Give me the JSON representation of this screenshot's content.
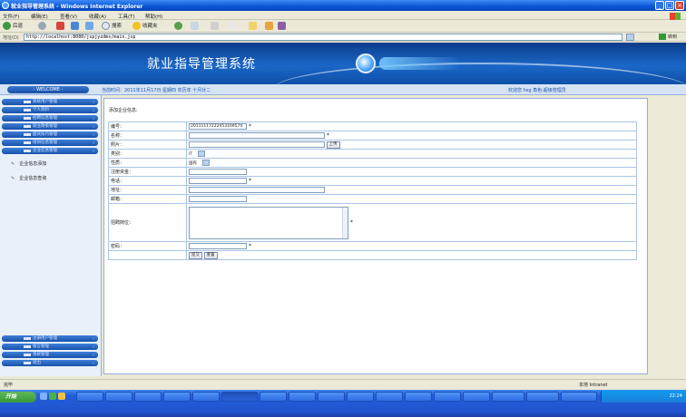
{
  "window": {
    "title": "就业指导管理系统 - Windows Internet Explorer",
    "controls": [
      "_",
      "□",
      "×"
    ]
  },
  "menubar": [
    "文件(F)",
    "编辑(E)",
    "查看(V)",
    "收藏(A)",
    "工具(T)",
    "帮助(H)"
  ],
  "toolbar": {
    "back": "后退",
    "search": "搜索",
    "favorites": "收藏夹"
  },
  "address": {
    "label": "地址(D)",
    "url": "http://localhost:8080/jspjyzdms/main.jsp",
    "go": "转到"
  },
  "app": {
    "title": "就业指导管理系统",
    "welcome": "- WELCOME -",
    "current_time": "当前时间：2011年11月17日 星期四 农历年 十月廿二",
    "user_info": "欢迎您 hsg 角色:超级管理员"
  },
  "sidebar": {
    "top_menus": [
      {
        "label": "系统用户管理"
      },
      {
        "label": "个人资料"
      },
      {
        "label": "招聘信息管理"
      },
      {
        "label": "就业政策管理"
      },
      {
        "label": "面试技巧管理"
      },
      {
        "label": "培训信息管理"
      },
      {
        "label": "企业信息管理"
      }
    ],
    "sub_items": [
      {
        "label": "企业信息添加"
      },
      {
        "label": "企业信息查询"
      }
    ],
    "bottom_menus": [
      {
        "label": "注册用户管理"
      },
      {
        "label": "留言管理"
      },
      {
        "label": "系统管理"
      },
      {
        "label": "退出"
      }
    ]
  },
  "form": {
    "heading": "添加企业信息:",
    "fields": {
      "id": {
        "label": "编号：",
        "value": "20111117222453169574",
        "required": "*"
      },
      "name": {
        "label": "名称：",
        "value": "",
        "required": "*"
      },
      "photo": {
        "label": "照片：",
        "value": "",
        "button": "上传"
      },
      "category": {
        "label": "类别：",
        "value": "IT"
      },
      "nature": {
        "label": "性质：",
        "value": "国有"
      },
      "capital": {
        "label": "注册资金：",
        "value": ""
      },
      "phone": {
        "label": "电话：",
        "value": "",
        "required": "*"
      },
      "address": {
        "label": "地址：",
        "value": ""
      },
      "email": {
        "label": "邮箱：",
        "value": ""
      },
      "positions": {
        "label": "招聘岗位：",
        "value": "",
        "required": "*"
      },
      "password": {
        "label": "密码：",
        "value": "",
        "required": "*"
      }
    },
    "submit": "提交",
    "reset": "重置"
  },
  "statusbar": {
    "status": "完毕",
    "zone": "本地 Intranet"
  },
  "taskbar": {
    "start": "开始",
    "clock": "22:24"
  }
}
